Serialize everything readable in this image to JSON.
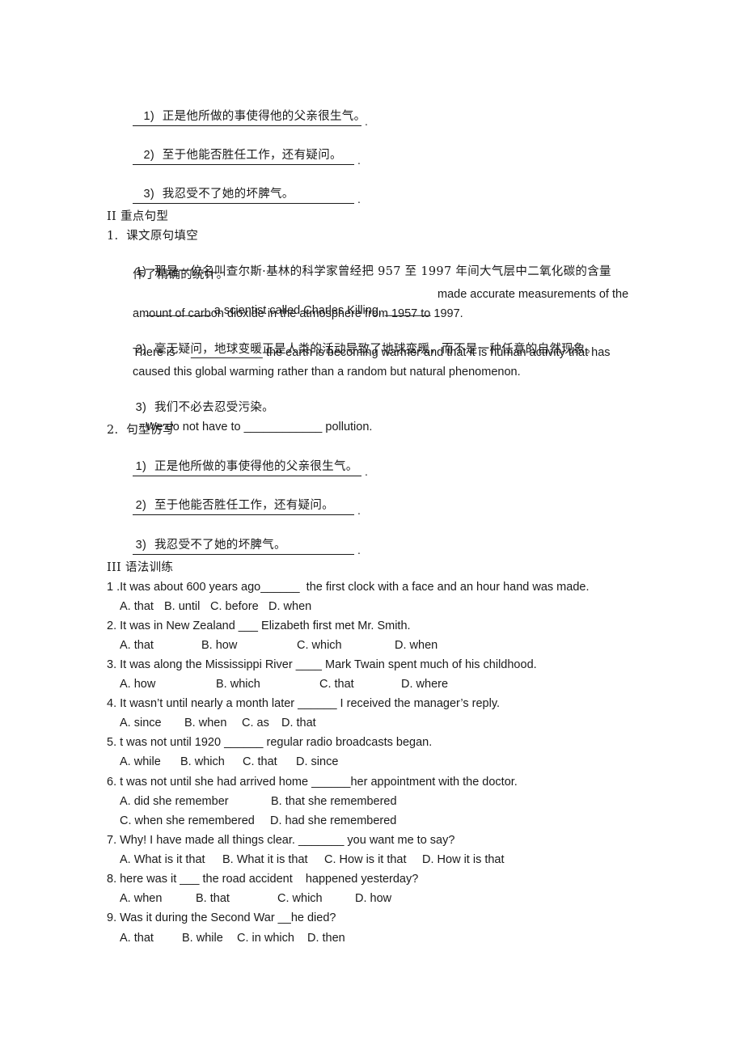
{
  "section_top": {
    "items": [
      {
        "num": "1)",
        "text": "正是他所做的事使得他的父亲很生气。"
      },
      {
        "num": "2)",
        "text": "至于他能否胜任工作，还有疑问。"
      },
      {
        "num": "3)",
        "text": "我忍受不了她的坏脾气。"
      }
    ],
    "blank_end": "."
  },
  "section2": {
    "heading": "II 重点句型",
    "part1": {
      "title": "1.  课文原句填空",
      "q1": {
        "num": "1)",
        "cn_line1": "那是一位名叫查尔斯·基林的科学家曾经把 957 至 1997 年间大气层中二氧化碳的含量",
        "cn_line2": "作了精确的统计。",
        "blank_a": "__________",
        "en_a": " a scientist called Charles Killing, ",
        "blank_b": "_______",
        "en_b": "made accurate measurements of the",
        "en_line2": "amount of carbon dioxide in the atmosphere from 1957 to 1997."
      },
      "q2": {
        "num": "2)",
        "cn": "毫无疑问，地球变暖正是人类的活动导致了地球变暖，而不是一种任意的自然现象。",
        "en_a": "There is",
        "blank": "___________",
        "en_b": "the earth is becoming warmer and that it is human activity that has",
        "en_line2": "caused this global warming rather than a random but natural phenomenon."
      },
      "q3": {
        "num": "3)",
        "cn": "我们不必去忍受污染。",
        "en_a": "We do not have to ",
        "blank": "____________",
        "en_b": " pollution."
      }
    },
    "part2": {
      "title": "2.  句型仿写",
      "items": [
        {
          "num": "1)",
          "text": "正是他所做的事使得他的父亲很生气。"
        },
        {
          "num": "2)",
          "text": "至于他能否胜任工作，还有疑问。"
        },
        {
          "num": "3)",
          "text": "我忍受不了她的坏脾气。"
        }
      ],
      "blank_end": "."
    }
  },
  "section3": {
    "heading": "III 语法训练",
    "questions": [
      {
        "stem": "1 .It was about 600 years ago______  the first clock with a face and an hour hand was made.",
        "options": [
          "A. that",
          "B. until",
          "C. before",
          "D. when"
        ]
      },
      {
        "stem": "2. It was in New Zealand ___ Elizabeth first met Mr. Smith.",
        "options": [
          "A. that",
          "B. how",
          "C. which",
          "D. when"
        ]
      },
      {
        "stem": "3. It was along the Mississippi River ____ Mark Twain spent much of his childhood.",
        "options": [
          "A. how",
          "B. which",
          "C. that",
          "D. where"
        ]
      },
      {
        "stem": "4. It wasn’t until nearly a month later ______ I received the manager’s reply.",
        "options": [
          "A. since",
          "B. when",
          "C. as",
          "D. that"
        ]
      },
      {
        "stem": "5. t was not until 1920 ______ regular radio broadcasts began.",
        "options": [
          "A. while",
          "B. which",
          "C. that",
          "D. since"
        ]
      },
      {
        "stem": "6. t was not until she had arrived home ______her appointment with the doctor.",
        "options": [
          "A. did she remember",
          "B. that she remembered",
          "C. when she remembered",
          "D. had she remembered"
        ]
      },
      {
        "stem": "7. Why! I have made all things clear. _______ you want me to say?",
        "options": [
          "A. What is it that",
          "B. What it is that",
          "C. How is it that",
          "D. How it is that"
        ]
      },
      {
        "stem": "8. here was it ___ the road accident    happened yesterday?",
        "options": [
          "A. when",
          "B. that",
          "C. which",
          "D. how"
        ]
      },
      {
        "stem": "9. Was it during the Second War __he died?",
        "options": [
          "A. that",
          "B. while",
          "C. in which",
          "D. then"
        ]
      }
    ]
  }
}
